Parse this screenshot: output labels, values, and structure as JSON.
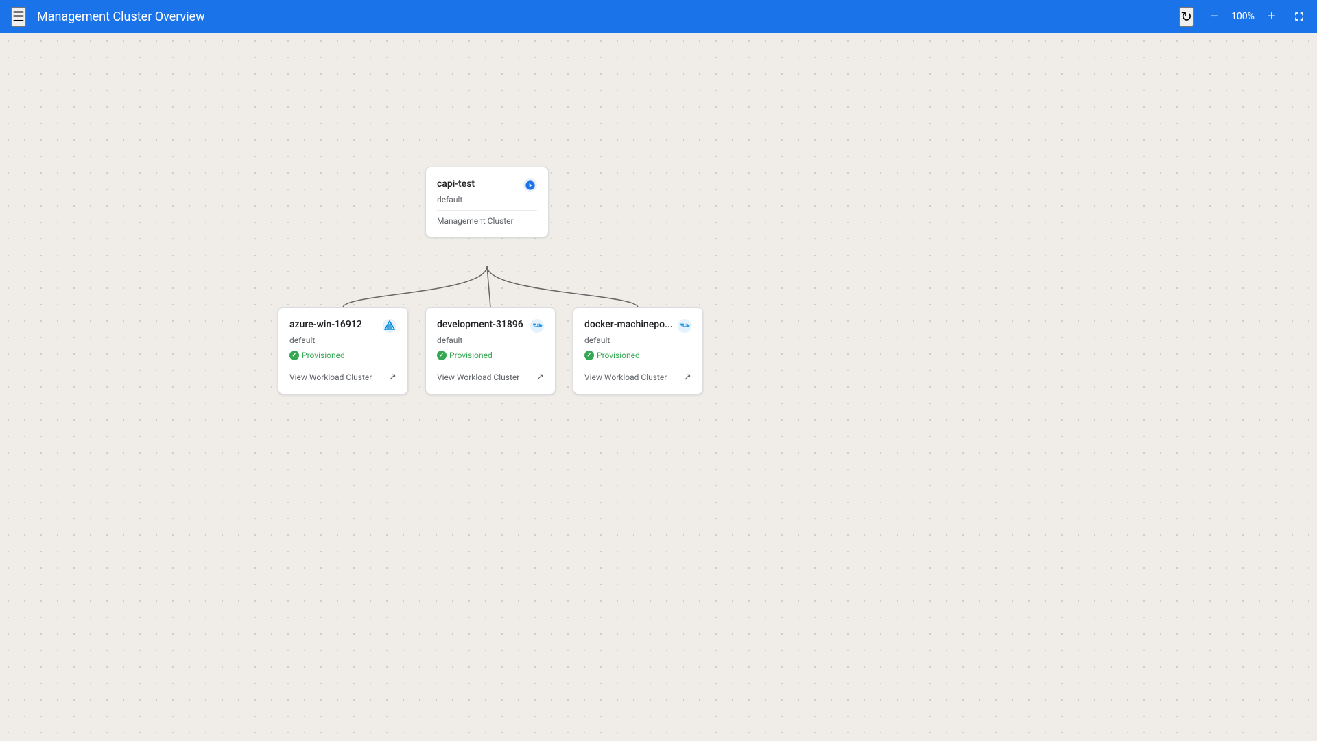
{
  "header": {
    "title": "Management Cluster Overview",
    "zoom": "100%",
    "menu_label": "menu",
    "refresh_label": "refresh",
    "zoom_out_label": "−",
    "zoom_in_label": "+",
    "fullscreen_label": "fullscreen"
  },
  "root_cluster": {
    "name": "capi-test",
    "namespace": "default",
    "type": "Management Cluster",
    "provider_icon": "⚙"
  },
  "child_clusters": [
    {
      "id": "azure",
      "name": "azure-win-16912",
      "namespace": "default",
      "status": "Provisioned",
      "view_label": "View Workload Cluster",
      "provider": "azure"
    },
    {
      "id": "development",
      "name": "development-31896",
      "namespace": "default",
      "status": "Provisioned",
      "view_label": "View Workload Cluster",
      "provider": "docker-blue"
    },
    {
      "id": "docker",
      "name": "docker-machinepo...",
      "namespace": "default",
      "status": "Provisioned",
      "view_label": "View Workload Cluster",
      "provider": "docker"
    }
  ]
}
